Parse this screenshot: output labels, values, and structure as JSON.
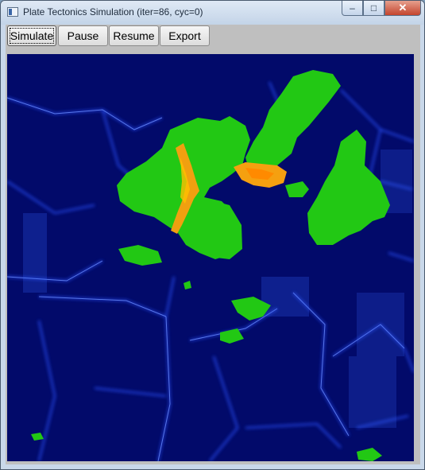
{
  "window": {
    "title": "Plate Tectonics Simulation (iter=86, cyc=0)",
    "icon": "app-window-icon",
    "controls": {
      "minimize": "–",
      "maximize": "□",
      "close": "✕"
    }
  },
  "toolbar": {
    "buttons": [
      {
        "label": "Simulate",
        "focused": true
      },
      {
        "label": "Pause"
      },
      {
        "label": "Resume"
      },
      {
        "label": "Export"
      }
    ]
  },
  "colors": {
    "ocean": "#020a6a",
    "ridge": "#2244ff",
    "land": "#22cc11",
    "mountain": "#ffaa00"
  }
}
